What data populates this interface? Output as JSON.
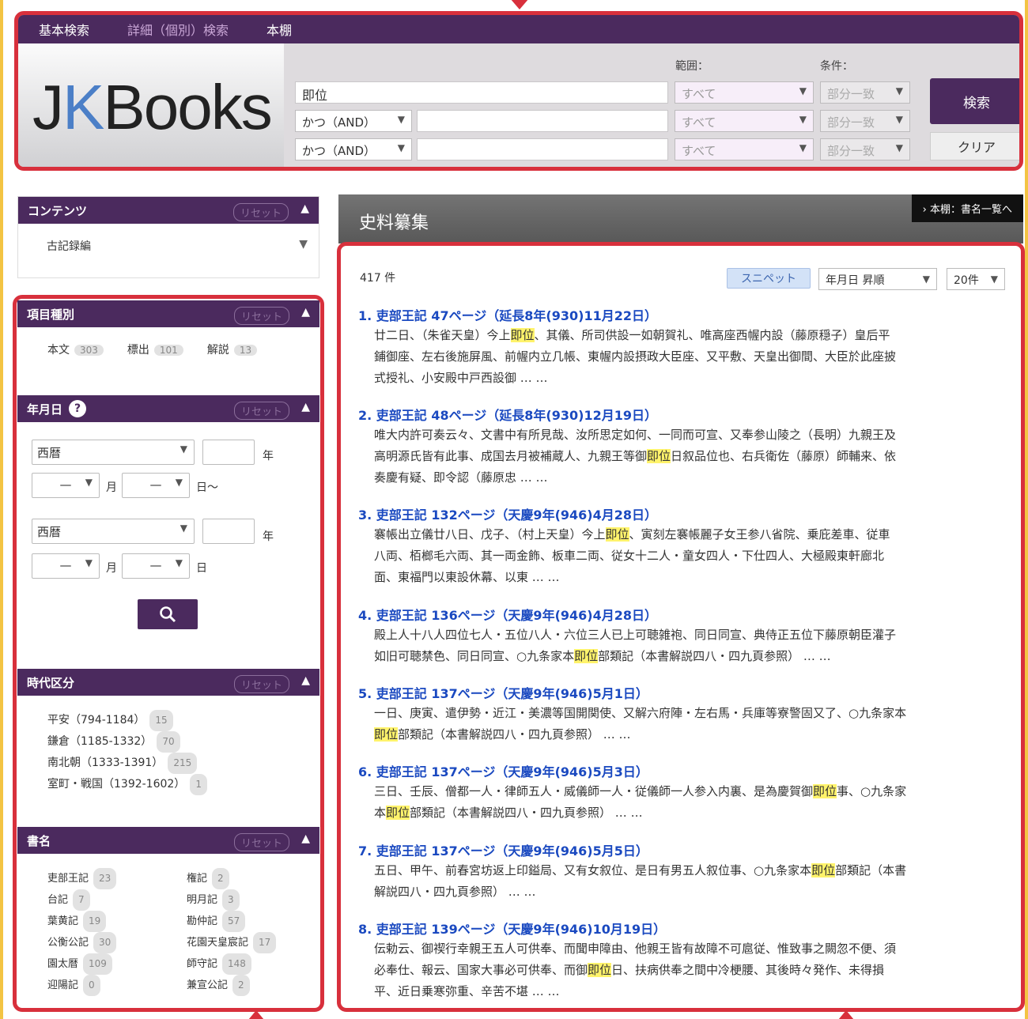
{
  "nav": {
    "basic_search": "基本検索",
    "detail_search": "詳細（個別）検索",
    "bookshelf": "本棚"
  },
  "logo": {
    "j": "J",
    "k": "K",
    "books": "Books"
  },
  "search": {
    "range_label": "範囲：",
    "condition_label": "条件：",
    "rows": [
      {
        "op": "",
        "query": "即位",
        "range": "すべて",
        "cond": "部分一致"
      },
      {
        "op": "かつ（AND）",
        "query": "",
        "range": "すべて",
        "cond": "部分一致"
      },
      {
        "op": "かつ（AND）",
        "query": "",
        "range": "すべて",
        "cond": "部分一致"
      }
    ],
    "search_button": "検索",
    "clear_button": "クリア"
  },
  "sidebar": {
    "contents": {
      "title": "コンテンツ",
      "reset": "リセット",
      "value": "古記録編"
    },
    "item_type": {
      "title": "項目種別",
      "reset": "リセット",
      "items": [
        {
          "label": "本文",
          "count": "303"
        },
        {
          "label": "標出",
          "count": "101"
        },
        {
          "label": "解説",
          "count": "13"
        }
      ]
    },
    "date": {
      "title": "年月日",
      "reset": "リセット",
      "calendar": "西暦",
      "year": "年",
      "month": "月",
      "day_from": "日～",
      "day": "日",
      "dash": "—"
    },
    "era": {
      "title": "時代区分",
      "reset": "リセット",
      "items": [
        {
          "label": "平安（794-1184）",
          "count": "15"
        },
        {
          "label": "鎌倉（1185-1332）",
          "count": "70"
        },
        {
          "label": "南北朝（1333-1391）",
          "count": "215"
        },
        {
          "label": "室町・戦国（1392-1602）",
          "count": "1"
        }
      ]
    },
    "book": {
      "title": "書名",
      "reset": "リセット",
      "items": [
        {
          "label": "吏部王記",
          "count": "23"
        },
        {
          "label": "権記",
          "count": "2"
        },
        {
          "label": "台記",
          "count": "7"
        },
        {
          "label": "明月記",
          "count": "3"
        },
        {
          "label": "葉黄記",
          "count": "19"
        },
        {
          "label": "勘仲記",
          "count": "57"
        },
        {
          "label": "公衡公記",
          "count": "30"
        },
        {
          "label": "花園天皇宸記",
          "count": "17"
        },
        {
          "label": "園太暦",
          "count": "109"
        },
        {
          "label": "師守記",
          "count": "148"
        },
        {
          "label": "迎陽記",
          "count": "0"
        },
        {
          "label": "兼宣公記",
          "count": "2"
        }
      ]
    }
  },
  "main": {
    "title": "史料纂集",
    "shelf_link": "本棚：書名一覧へ",
    "count": "417 件",
    "snippet": "スニペット",
    "sort": "年月日 昇順",
    "per_page": "20件",
    "results": [
      {
        "title": "1. 吏部王記 47ページ（延長8年(930)11月22日）",
        "parts": [
          "廿二日、（朱雀天皇）今上",
          "即位",
          "、其儀、所司供設一如朝賀礼、唯高座西幄内設（藤原穏子）皇后平",
          "",
          "",
          ""
        ],
        "lines": [
          "廿二日、（朱雀天皇）今上即位、其儀、所司供設一如朝賀礼、唯高座西幄内設（藤原穏子）皇后平",
          "鋪御座、左右後施屏風、前幄内立几帳、東幄内設摂政大臣座、又平敷、天皇出御間、大臣於此座披",
          "式授礼、小安殿中戸西設御 … …"
        ]
      },
      {
        "title": "2. 吏部王記 48ページ（延長8年(930)12月19日）",
        "lines": [
          "唯大内許可奏云々、文書中有所見哉、汝所思定如何、一同而可宣、又奉参山陵之（長明）九親王及",
          "高明源氏皆有此事、成国去月被補蔵人、九親王等御即位日叙品位也、右兵衛佐（藤原）師輔来、依",
          "奏慶有疑、即令認（藤原忠 … …"
        ]
      },
      {
        "title": "3. 吏部王記 132ページ（天慶9年(946)4月28日）",
        "lines": [
          "褰帳出立儀廿八日、戊子、（村上天皇）今上即位、寅刻左褰帳麗子女王参八省院、乗庇差車、従車",
          "八両、栢榔毛六両、其一両金飾、板車二両、従女十二人・童女四人・下仕四人、大極殿東軒廊北",
          "面、東福門以東設休幕、以東 … …"
        ]
      },
      {
        "title": "4. 吏部王記 136ページ（天慶9年(946)4月28日）",
        "lines": [
          "殿上人十八人四位七人・五位八人・六位三人已上可聴雑袍、同日同宣、典侍正五位下藤原朝臣灌子",
          "如旧可聴禁色、同日同宣、○九条家本即位部類記（本書解説四八・四九頁参照） … …"
        ]
      },
      {
        "title": "5. 吏部王記 137ページ（天慶9年(946)5月1日）",
        "lines": [
          "一日、庚寅、遣伊勢・近江・美濃等国開関使、又解六府陣・左右馬・兵庫等寮警固又了、○九条家本",
          "即位部類記（本書解説四八・四九頁参照） … …"
        ]
      },
      {
        "title": "6. 吏部王記 137ページ（天慶9年(946)5月3日）",
        "lines": [
          "三日、壬辰、僧都一人・律師五人・威儀師一人・従儀師一人参入内裏、是為慶賀御即位事、○九条家",
          "本即位部類記（本書解説四八・四九頁参照） … …"
        ]
      },
      {
        "title": "7. 吏部王記 137ページ（天慶9年(946)5月5日）",
        "lines": [
          "五日、甲午、前春宮坊返上印鎰局、又有女叙位、是日有男五人叙位事、○九条家本即位部類記（本書",
          "解説四八・四九頁参照） … …"
        ]
      },
      {
        "title": "8. 吏部王記 139ページ（天慶9年(946)10月19日）",
        "lines": [
          "伝勅云、御禊行幸親王五人可供奉、而聞申障由、他親王皆有故障不可扈従、惟致事之闕忽不便、須",
          "必奉仕、報云、国家大事必可供奉、而御即位日、扶病供奉之間中冷梗腰、其後時々発作、未得損",
          "平、近日乗寒弥重、辛苦不堪 … …"
        ]
      }
    ]
  }
}
